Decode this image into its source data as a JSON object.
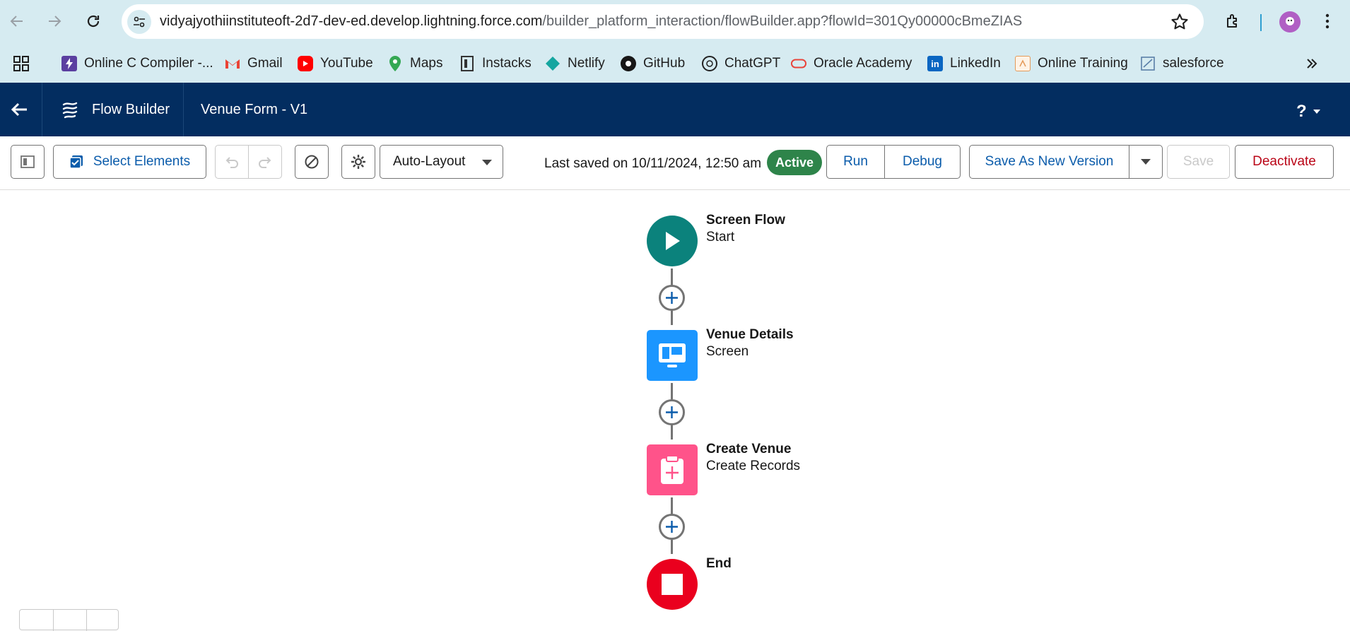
{
  "browser": {
    "url_host": "vidyajyothiinstituteoft-2d7-dev-ed.develop.lightning.force.com",
    "url_path": "/builder_platform_interaction/flowBuilder.app?flowId=301Qy00000cBmeZIAS",
    "bookmarks": [
      {
        "label": "Online C Compiler -...",
        "icon": "lightning-icon",
        "color": "#5b3fa0"
      },
      {
        "label": "Gmail",
        "icon": "gmail-icon",
        "color": "#ea4335"
      },
      {
        "label": "YouTube",
        "icon": "youtube-icon",
        "color": "#ff0000"
      },
      {
        "label": "Maps",
        "icon": "maps-icon",
        "color": "#34a853"
      },
      {
        "label": "Instacks",
        "icon": "instacks-icon",
        "color": "#333333"
      },
      {
        "label": "Netlify",
        "icon": "netlify-icon",
        "color": "#15a6a0"
      },
      {
        "label": "GitHub",
        "icon": "github-icon",
        "color": "#181717"
      },
      {
        "label": "ChatGPT",
        "icon": "chatgpt-icon",
        "color": "#222222"
      },
      {
        "label": "Oracle Academy",
        "icon": "oracle-icon",
        "color": "#e8453c"
      },
      {
        "label": "LinkedIn",
        "icon": "linkedin-icon",
        "color": "#0a66c2"
      },
      {
        "label": "Online Training",
        "icon": "training-icon",
        "color": "#e39a5a"
      },
      {
        "label": "salesforce",
        "icon": "salesforce-icon",
        "color": "#5a7fa8"
      }
    ]
  },
  "header": {
    "app_name": "Flow Builder",
    "flow_name": "Venue Form - V1",
    "help_label": "?"
  },
  "toolbar": {
    "select_elements_label": "Select Elements",
    "layout_label": "Auto-Layout",
    "last_saved": "Last saved on 10/11/2024, 12:50 am",
    "status_badge": "Active",
    "run_label": "Run",
    "debug_label": "Debug",
    "save_new_version_label": "Save As New Version",
    "save_label": "Save",
    "deactivate_label": "Deactivate"
  },
  "flow": {
    "nodes": [
      {
        "title": "Screen Flow",
        "subtitle": "Start",
        "icon": "play-icon",
        "color": "#0b827c"
      },
      {
        "title": "Venue Details",
        "subtitle": "Screen",
        "icon": "screen-icon",
        "color": "#1b96ff"
      },
      {
        "title": "Create Venue",
        "subtitle": "Create Records",
        "icon": "record-create-icon",
        "color": "#ff538a"
      },
      {
        "title": "End",
        "subtitle": "",
        "icon": "stop-icon",
        "color": "#ea001e"
      }
    ]
  },
  "colors": {
    "sf_header": "#032d60",
    "brand_blue": "#0b5cab",
    "active_green": "#2e844a",
    "destructive_red": "#ba0517"
  }
}
